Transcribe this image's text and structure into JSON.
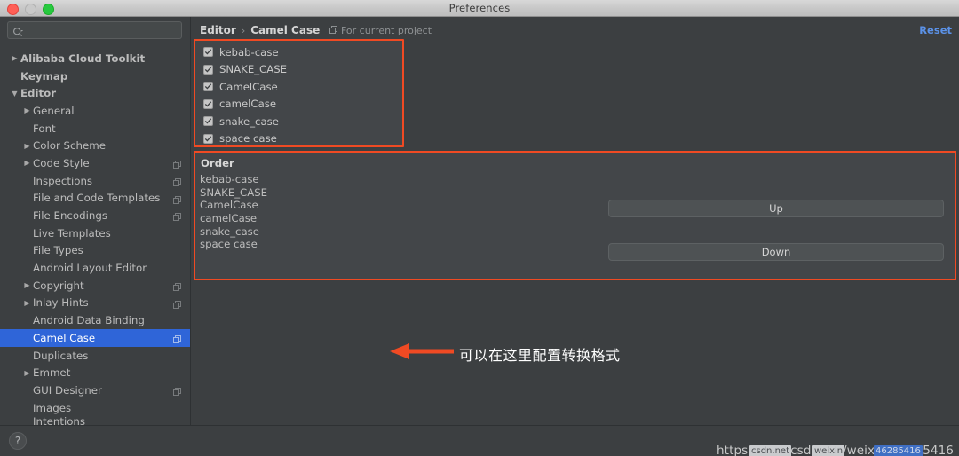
{
  "window": {
    "title": "Preferences",
    "traffic_lights": [
      "close-red",
      "minimize-gray",
      "zoom-green"
    ]
  },
  "sidebar": {
    "search": {
      "value": "",
      "placeholder": "",
      "icon": "search-icon"
    },
    "items": [
      {
        "label": "",
        "level": 1,
        "twisty": "",
        "cut": "top",
        "copy": false
      },
      {
        "label": "Alibaba Cloud Toolkit",
        "level": 1,
        "twisty": "▶",
        "bold": true,
        "copy": false
      },
      {
        "label": "Keymap",
        "level": 1,
        "twisty": "",
        "bold": true,
        "copy": false
      },
      {
        "label": "Editor",
        "level": 1,
        "twisty": "▼",
        "bold": true,
        "copy": false
      },
      {
        "label": "General",
        "level": 2,
        "twisty": "▶",
        "copy": false
      },
      {
        "label": "Font",
        "level": 2,
        "twisty": "",
        "copy": false
      },
      {
        "label": "Color Scheme",
        "level": 2,
        "twisty": "▶",
        "copy": false
      },
      {
        "label": "Code Style",
        "level": 2,
        "twisty": "▶",
        "copy": true
      },
      {
        "label": "Inspections",
        "level": 2,
        "twisty": "",
        "copy": true
      },
      {
        "label": "File and Code Templates",
        "level": 2,
        "twisty": "",
        "copy": true
      },
      {
        "label": "File Encodings",
        "level": 2,
        "twisty": "",
        "copy": true
      },
      {
        "label": "Live Templates",
        "level": 2,
        "twisty": "",
        "copy": false
      },
      {
        "label": "File Types",
        "level": 2,
        "twisty": "",
        "copy": false
      },
      {
        "label": "Android Layout Editor",
        "level": 2,
        "twisty": "",
        "copy": false
      },
      {
        "label": "Copyright",
        "level": 2,
        "twisty": "▶",
        "copy": true
      },
      {
        "label": "Inlay Hints",
        "level": 2,
        "twisty": "▶",
        "copy": true
      },
      {
        "label": "Android Data Binding",
        "level": 2,
        "twisty": "",
        "copy": false
      },
      {
        "label": "Camel Case",
        "level": 2,
        "twisty": "",
        "copy": true,
        "selected": true
      },
      {
        "label": "Duplicates",
        "level": 2,
        "twisty": "",
        "copy": false
      },
      {
        "label": "Emmet",
        "level": 2,
        "twisty": "▶",
        "copy": false
      },
      {
        "label": "GUI Designer",
        "level": 2,
        "twisty": "",
        "copy": true
      },
      {
        "label": "Images",
        "level": 2,
        "twisty": "",
        "copy": false
      },
      {
        "label": "Intentions",
        "level": 2,
        "twisty": "",
        "cut": "bottom",
        "copy": false
      }
    ],
    "selected_label": "Camel Case"
  },
  "header": {
    "breadcrumb_parent": "Editor",
    "breadcrumb_separator": "›",
    "breadcrumb_current": "Camel Case",
    "for_current_project": "For current project",
    "reset_label": "Reset"
  },
  "case_options": {
    "items": [
      {
        "label": "kebab-case",
        "checked": true
      },
      {
        "label": "SNAKE_CASE",
        "checked": true
      },
      {
        "label": "CamelCase",
        "checked": true
      },
      {
        "label": "camelCase",
        "checked": true
      },
      {
        "label": "snake_case",
        "checked": true
      },
      {
        "label": "space case",
        "checked": true
      }
    ]
  },
  "order": {
    "title": "Order",
    "items": [
      "kebab-case",
      "SNAKE_CASE",
      "CamelCase",
      "camelCase",
      "snake_case",
      "space case"
    ],
    "up_label": "Up",
    "down_label": "Down"
  },
  "annotation": {
    "text": "可以在这里配置转换格式",
    "arrow_color": "#f04a23"
  },
  "footer": {
    "help_glyph": "?"
  },
  "watermark": {
    "url": "https://blog.csdn.net/weixin_46285416",
    "overlay_1": "csdn.net",
    "overlay_2": "weixin",
    "overlay_3": "46285416"
  },
  "colors": {
    "accent_highlight": "#f04a23",
    "selection_blue": "#2f65d8",
    "link_blue": "#5b92e8",
    "panel_bg": "#3c3f41",
    "group_bg": "#434649"
  }
}
